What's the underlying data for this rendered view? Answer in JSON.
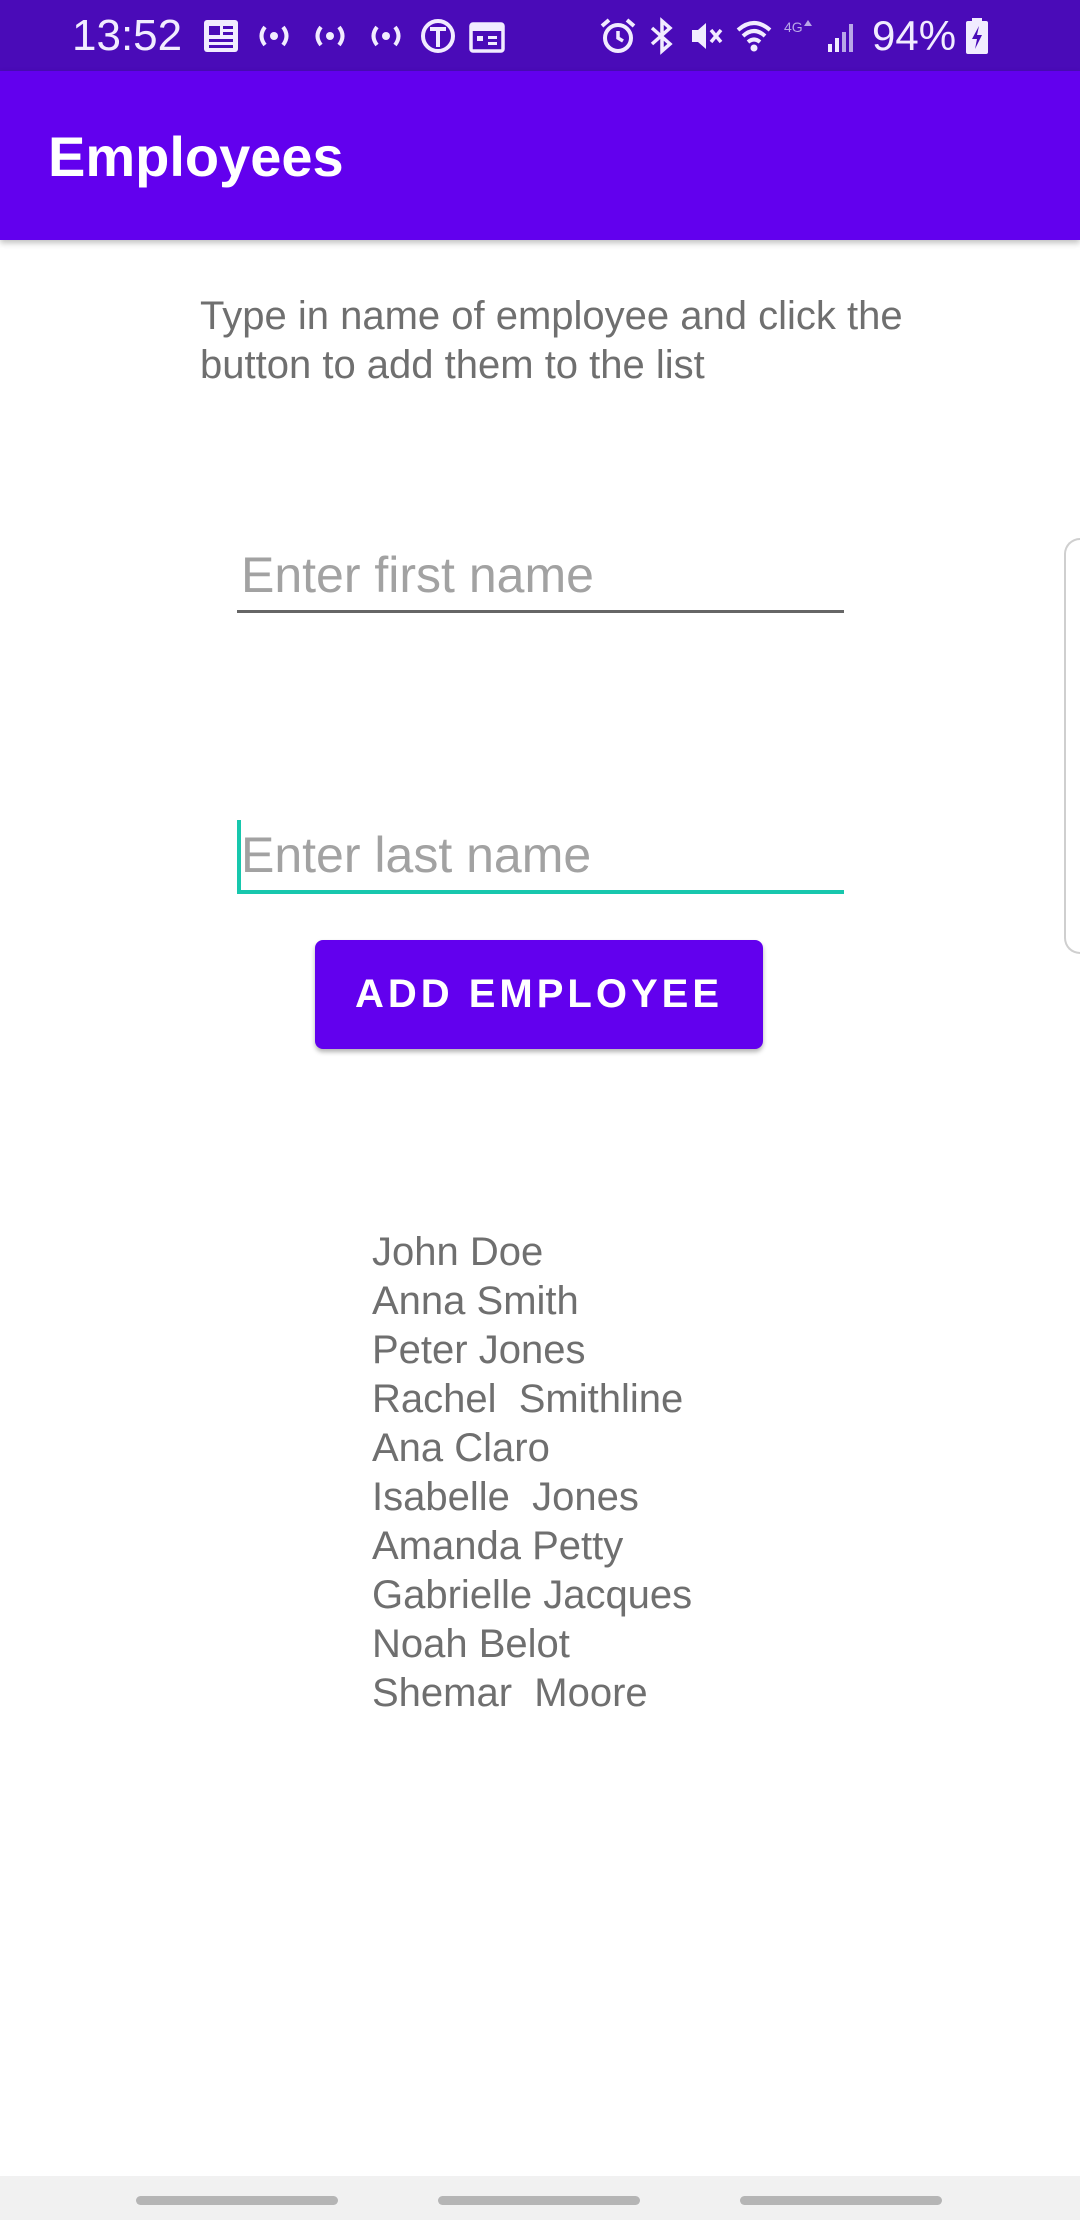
{
  "status_bar": {
    "time": "13:52",
    "battery": "94%",
    "left_icons": [
      "news-icon",
      "broadcast-icon",
      "broadcast-icon",
      "broadcast-icon",
      "nyt-icon",
      "calendar-icon"
    ],
    "right_icons": [
      "alarm-icon",
      "bluetooth-icon",
      "vibrate-icon",
      "wifi-icon",
      "lte-icon",
      "signal-icon",
      "battery-charging-icon"
    ]
  },
  "app_bar": {
    "title": "Employees"
  },
  "form": {
    "instructions": "Type in name of employee and click the button to add them to the list",
    "first_name": {
      "value": "",
      "placeholder": "Enter first name"
    },
    "last_name": {
      "value": "",
      "placeholder": "Enter last name"
    },
    "add_button_label": "ADD EMPLOYEE"
  },
  "employees": [
    "John Doe",
    "Anna Smith",
    "Peter Jones",
    "Rachel  Smithline",
    "Ana Claro",
    "Isabelle  Jones",
    "Amanda Petty",
    "Gabrielle Jacques",
    "Noah Belot",
    "Shemar  Moore"
  ],
  "colors": {
    "status_bar": "#4a0bb8",
    "primary": "#6200ee",
    "accent": "#17c7ad",
    "text_secondary": "#6f6f6f"
  }
}
